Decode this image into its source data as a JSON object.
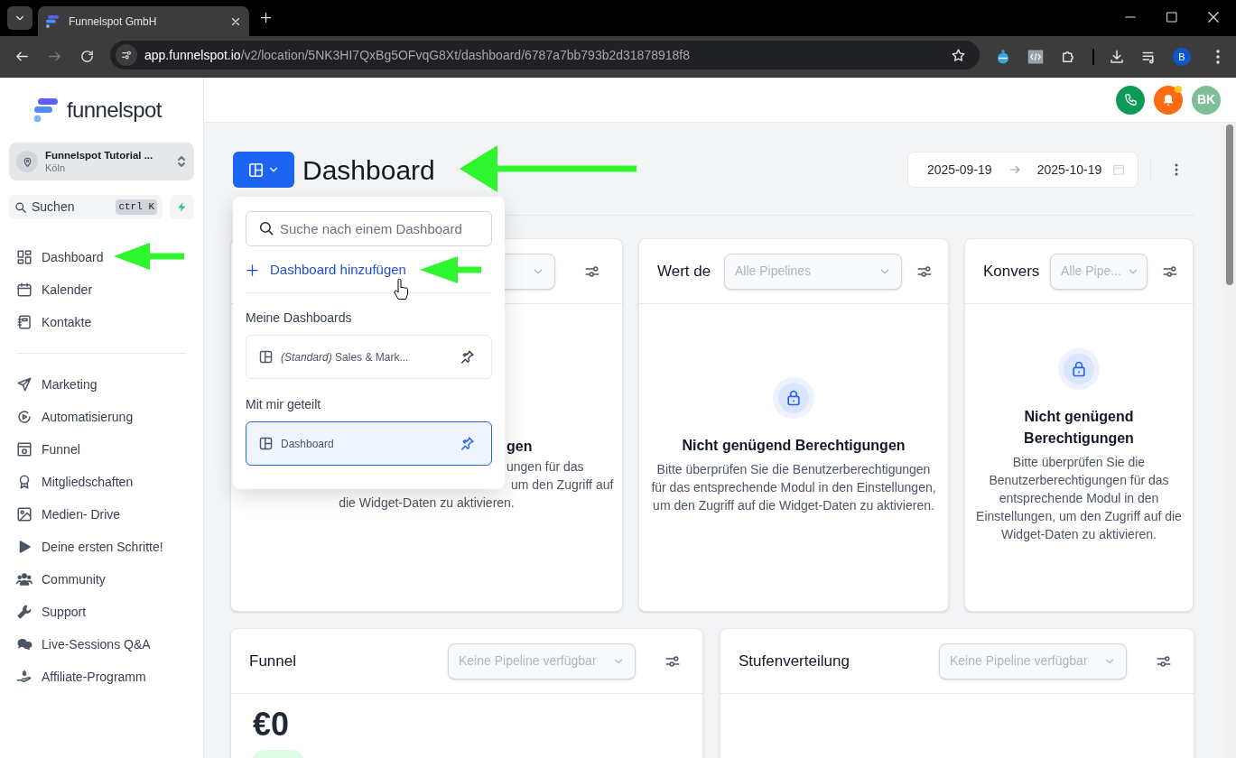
{
  "browser": {
    "tab_title": "Funnelspot GmbH",
    "url_host": "app.funnelspot.io",
    "url_path": "/v2/location/5NK3HI7QxBg5OFvqG8Xt/dashboard/6787a7bb793b2d31878918f8",
    "forward_disabled": true,
    "profile_initial": "B"
  },
  "sidebar": {
    "logo_text": "funnelspot",
    "location": {
      "name": "Funnelspot Tutorial ...",
      "city": "Köln"
    },
    "search": {
      "placeholder": "Suchen",
      "shortcut": "ctrl K"
    },
    "nav_groups": [
      {
        "items": [
          {
            "label": "Dashboard"
          },
          {
            "label": "Kalender"
          },
          {
            "label": "Kontakte"
          }
        ]
      },
      {
        "items": [
          {
            "label": "Marketing"
          },
          {
            "label": "Automatisierung"
          },
          {
            "label": "Funnel"
          },
          {
            "label": "Mitgliedschaften"
          },
          {
            "label": "Medien- Drive"
          },
          {
            "label": "Deine ersten Schritte!"
          },
          {
            "label": "Community"
          },
          {
            "label": "Support"
          },
          {
            "label": "Live-Sessions Q&A"
          },
          {
            "label": "Affiliate-Programm"
          }
        ]
      }
    ]
  },
  "header": {
    "notification_dot": true,
    "avatar_initials": "BK"
  },
  "page": {
    "title": "Dashboard",
    "date_from": "2025-09-19",
    "date_to": "2025-10-19"
  },
  "dashboard_menu": {
    "search_placeholder": "Suche nach einem Dashboard",
    "add_label": "Dashboard hinzufügen",
    "sections": [
      {
        "heading": "Meine Dashboards",
        "items": [
          {
            "label": "*(Standard)* Sales & Mark...",
            "selected": false
          }
        ]
      },
      {
        "heading": "Mit mir geteilt",
        "items": [
          {
            "label": "Dashboard",
            "selected": true
          }
        ]
      }
    ]
  },
  "widgets": [
    {
      "kind": "covered",
      "fragments": [
        "gen",
        "ungen für das",
        "um den Zugriff auf"
      ],
      "message_tail": "die Widget-Daten zu aktivieren."
    },
    {
      "kind": "locked",
      "title": "Wert de",
      "select": "Alle Pipelines",
      "heading": "Nicht genügend Berechtigungen",
      "message": "Bitte überprüfen Sie die Benutzerberechtigungen für das entsprechende Modul in den Einstellungen, um den Zugriff auf die Widget-Daten zu aktivieren."
    },
    {
      "kind": "locked",
      "title": "Konvers",
      "select": "Alle Pipe...",
      "heading": "Nicht genügend Berechtigungen",
      "message": "Bitte überprüfen Sie die Benutzerberechtigungen für das entsprechende Modul in den Einstellungen, um den Zugriff auf die Widget-Daten zu aktivieren."
    },
    {
      "kind": "value",
      "title": "Funnel",
      "select": "Keine Pipeline verfügbar",
      "value": "€0"
    },
    {
      "kind": "empty",
      "title": "Stufenverteilung",
      "select": "Keine Pipeline verfügbar"
    }
  ]
}
